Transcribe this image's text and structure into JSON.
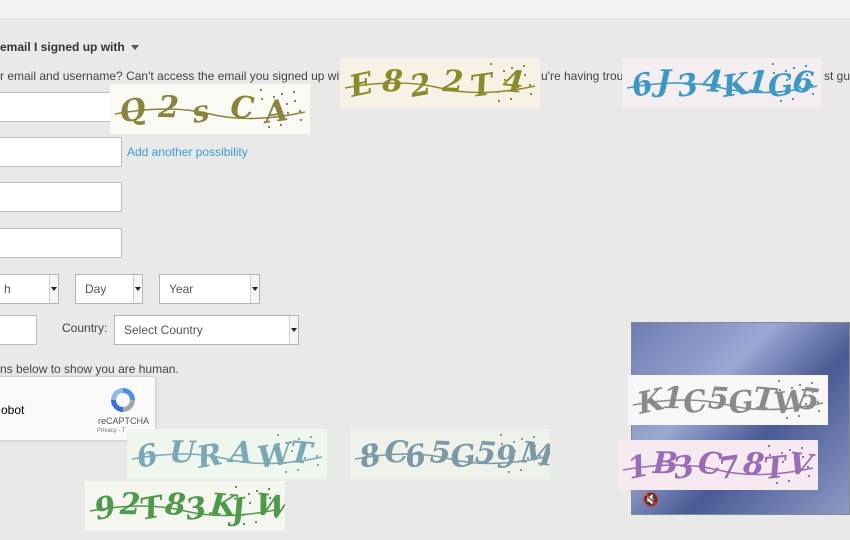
{
  "form": {
    "heading": "email I signed up with",
    "help_text": "r email and username? Can't access the email you signed up with? P",
    "help_text_2": "u're having troub",
    "help_text_3": "st gu",
    "add_link": "Add another possibility",
    "month_select": "h",
    "day_select": "Day",
    "year_select": "Year",
    "country_label": "Country:",
    "country_select": "Select Country",
    "human_text": "ns below to show you are human."
  },
  "recaptcha": {
    "checkbox_label": "obot",
    "brand": "reCAPTCHA",
    "privacy": "Privacy - T"
  },
  "captchas": [
    {
      "text": "Q2sCA",
      "color": "#8a8440"
    },
    {
      "text": "E822T4",
      "color": "#8c8a2c"
    },
    {
      "text": "6J34K1G6",
      "color": "#3d98c4"
    },
    {
      "text": "K1C5GTW5",
      "color": "#8a8a8a"
    },
    {
      "text": "1B3C78TV",
      "color": "#9b6bb6"
    },
    {
      "text": "6URAWT",
      "color": "#7aa8b4"
    },
    {
      "text": "8C65G59M",
      "color": "#7c9aa6"
    },
    {
      "text": "92T83KJW",
      "color": "#4e9a4a"
    }
  ],
  "video": {
    "mute_icon": "speaker-muted-icon"
  }
}
